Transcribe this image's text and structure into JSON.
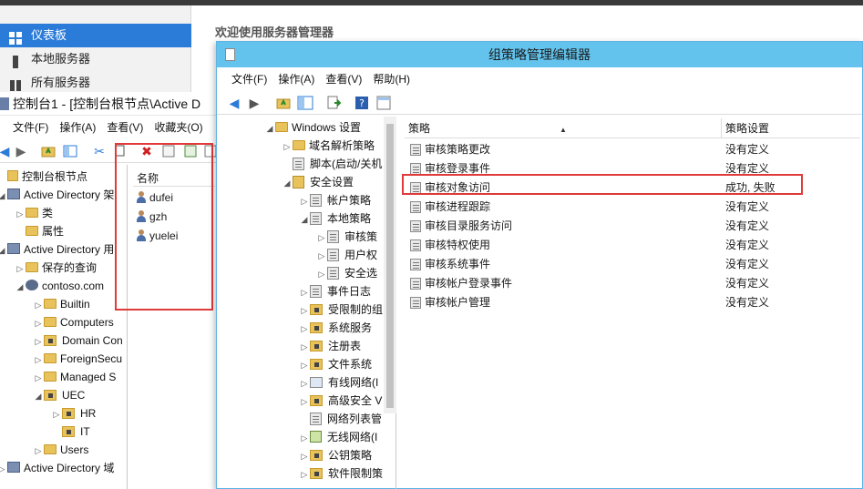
{
  "server_manager": {
    "nav": [
      {
        "label": "仪表板",
        "active": true
      },
      {
        "label": "本地服务器",
        "active": false
      },
      {
        "label": "所有服务器",
        "active": false
      }
    ],
    "welcome": "欢迎使用服务器管理器"
  },
  "console1": {
    "title": "控制台1 - [控制台根节点\\Active D",
    "menu": [
      "文件(F)",
      "操作(A)",
      "查看(V)",
      "收藏夹(O)"
    ],
    "tree": [
      {
        "label": "控制台根节点",
        "indent": 0,
        "arrow": "",
        "icon": "root"
      },
      {
        "label": "Active Directory 架",
        "indent": 0,
        "arrow": "◢",
        "icon": "ad"
      },
      {
        "label": "类",
        "indent": 1,
        "arrow": "▷",
        "icon": "folder"
      },
      {
        "label": "属性",
        "indent": 1,
        "arrow": "",
        "icon": "folder"
      },
      {
        "label": "Active Directory 用",
        "indent": 0,
        "arrow": "◢",
        "icon": "ad"
      },
      {
        "label": "保存的查询",
        "indent": 1,
        "arrow": "▷",
        "icon": "folder"
      },
      {
        "label": "contoso.com",
        "indent": 1,
        "arrow": "◢",
        "icon": "domain"
      },
      {
        "label": "Builtin",
        "indent": 2,
        "arrow": "▷",
        "icon": "folder"
      },
      {
        "label": "Computers",
        "indent": 2,
        "arrow": "▷",
        "icon": "folder"
      },
      {
        "label": "Domain Con",
        "indent": 2,
        "arrow": "▷",
        "icon": "lockfolder"
      },
      {
        "label": "ForeignSecu",
        "indent": 2,
        "arrow": "▷",
        "icon": "folder"
      },
      {
        "label": "Managed S",
        "indent": 2,
        "arrow": "▷",
        "icon": "folder"
      },
      {
        "label": "UEC",
        "indent": 2,
        "arrow": "◢",
        "icon": "lockfolder"
      },
      {
        "label": "HR",
        "indent": 3,
        "arrow": "▷",
        "icon": "lockfolder"
      },
      {
        "label": "IT",
        "indent": 3,
        "arrow": "",
        "icon": "lockfolder"
      },
      {
        "label": "Users",
        "indent": 2,
        "arrow": "▷",
        "icon": "folder"
      },
      {
        "label": "Active Directory 域",
        "indent": 0,
        "arrow": "▷",
        "icon": "ad"
      }
    ],
    "list_header": "名称",
    "users": [
      "dufei",
      "gzh",
      "yuelei"
    ]
  },
  "gpm": {
    "title": "组策略管理编辑器",
    "menu": [
      "文件(F)",
      "操作(A)",
      "查看(V)",
      "帮助(H)"
    ],
    "tree": [
      {
        "label": "Windows 设置",
        "indent": 0,
        "arrow": "◢",
        "icon": "folder"
      },
      {
        "label": "域名解析策略",
        "indent": 1,
        "arrow": "▷",
        "icon": "folder"
      },
      {
        "label": "脚本(启动/关机",
        "indent": 1,
        "arrow": "",
        "icon": "policy"
      },
      {
        "label": "安全设置",
        "indent": 1,
        "arrow": "◢",
        "icon": "sec"
      },
      {
        "label": "帐户策略",
        "indent": 2,
        "arrow": "▷",
        "icon": "policy"
      },
      {
        "label": "本地策略",
        "indent": 2,
        "arrow": "◢",
        "icon": "policy"
      },
      {
        "label": "审核策",
        "indent": 3,
        "arrow": "▷",
        "icon": "policy"
      },
      {
        "label": "用户权",
        "indent": 3,
        "arrow": "▷",
        "icon": "policy"
      },
      {
        "label": "安全选",
        "indent": 3,
        "arrow": "▷",
        "icon": "policy"
      },
      {
        "label": "事件日志",
        "indent": 2,
        "arrow": "▷",
        "icon": "policy"
      },
      {
        "label": "受限制的组",
        "indent": 2,
        "arrow": "▷",
        "icon": "lockfolder"
      },
      {
        "label": "系统服务",
        "indent": 2,
        "arrow": "▷",
        "icon": "lockfolder"
      },
      {
        "label": "注册表",
        "indent": 2,
        "arrow": "▷",
        "icon": "lockfolder"
      },
      {
        "label": "文件系统",
        "indent": 2,
        "arrow": "▷",
        "icon": "lockfolder"
      },
      {
        "label": "有线网络(I",
        "indent": 2,
        "arrow": "▷",
        "icon": "net"
      },
      {
        "label": "高级安全 V",
        "indent": 2,
        "arrow": "▷",
        "icon": "lockfolder"
      },
      {
        "label": "网络列表管",
        "indent": 2,
        "arrow": "",
        "icon": "policy"
      },
      {
        "label": "无线网络(I",
        "indent": 2,
        "arrow": "▷",
        "icon": "chart"
      },
      {
        "label": "公钥策略",
        "indent": 2,
        "arrow": "▷",
        "icon": "lockfolder"
      },
      {
        "label": "软件限制策",
        "indent": 2,
        "arrow": "▷",
        "icon": "lockfolder"
      }
    ],
    "columns": {
      "policy": "策略",
      "setting": "策略设置"
    },
    "policies": [
      {
        "name": "审核策略更改",
        "value": "没有定义"
      },
      {
        "name": "审核登录事件",
        "value": "没有定义"
      },
      {
        "name": "审核对象访问",
        "value": "成功, 失败"
      },
      {
        "name": "审核进程跟踪",
        "value": "没有定义"
      },
      {
        "name": "审核目录服务访问",
        "value": "没有定义"
      },
      {
        "name": "审核特权使用",
        "value": "没有定义"
      },
      {
        "name": "审核系统事件",
        "value": "没有定义"
      },
      {
        "name": "审核帐户登录事件",
        "value": "没有定义"
      },
      {
        "name": "审核帐户管理",
        "value": "没有定义"
      }
    ]
  },
  "colors": {
    "accent": "#2b7bd8",
    "gpm_title": "#63c3ec",
    "highlight_box": "#e03a3a"
  }
}
